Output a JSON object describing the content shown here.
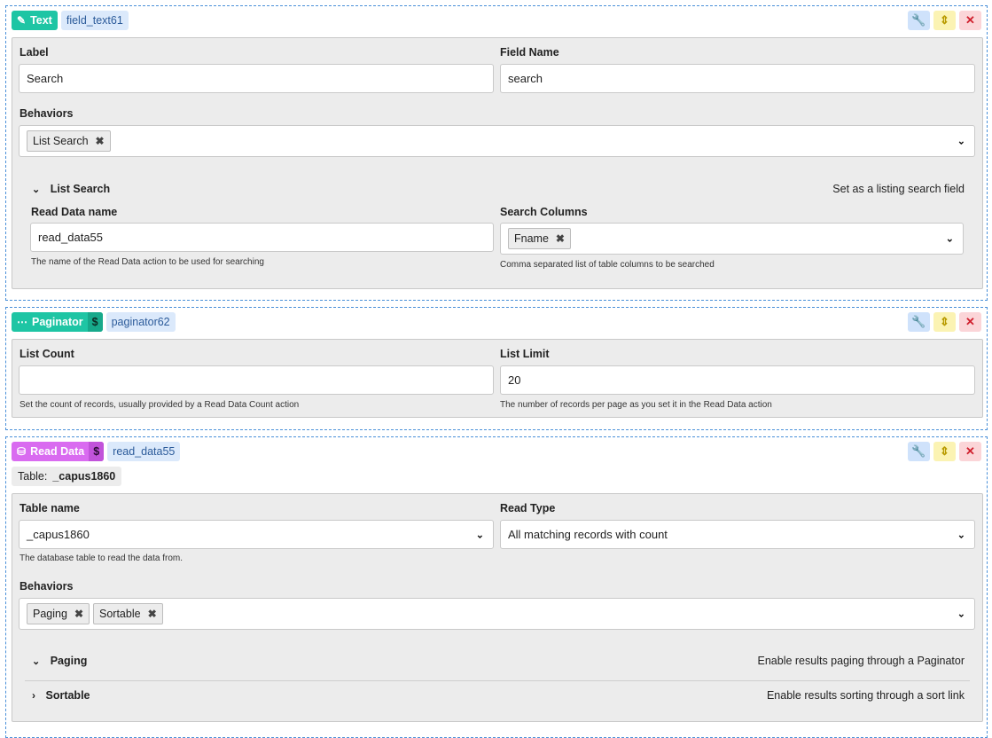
{
  "text_block": {
    "type_label": "Text",
    "id_label": "field_text61",
    "label_title": "Label",
    "label_value": "Search",
    "field_name_title": "Field Name",
    "field_name_value": "search",
    "behaviors_title": "Behaviors",
    "behaviors": [
      "List Search"
    ],
    "list_search": {
      "title": "List Search",
      "description": "Set as a listing search field",
      "read_data_title": "Read Data name",
      "read_data_value": "read_data55",
      "read_data_help": "The name of the Read Data action to be used for searching",
      "search_columns_title": "Search Columns",
      "search_columns": [
        "Fname"
      ],
      "search_columns_help": "Comma separated list of table columns to be searched"
    }
  },
  "paginator_block": {
    "type_label": "Paginator",
    "dollar": "$",
    "id_label": "paginator62",
    "list_count_title": "List Count",
    "list_count_value": "",
    "list_count_help": "Set the count of records, usually provided by a Read Data Count action",
    "list_limit_title": "List Limit",
    "list_limit_value": "20",
    "list_limit_help": "The number of records per page as you set it in the Read Data action"
  },
  "read_block": {
    "type_label": "Read Data",
    "dollar": "$",
    "id_label": "read_data55",
    "table_badge_label": "Table:",
    "table_badge_value": "_capus1860",
    "table_name_title": "Table name",
    "table_name_value": "_capus1860",
    "table_name_help": "The database table to read the data from.",
    "read_type_title": "Read Type",
    "read_type_value": "All matching records with count",
    "behaviors_title": "Behaviors",
    "behaviors": [
      "Paging",
      "Sortable"
    ],
    "paging": {
      "title": "Paging",
      "description": "Enable results paging through a Paginator"
    },
    "sortable": {
      "title": "Sortable",
      "description": "Enable results sorting through a sort link"
    }
  },
  "icons": {
    "text": "edit-icon",
    "paginator": "dots-icon",
    "read": "database-icon",
    "wrench": "wrench-icon",
    "move": "sort-icon",
    "delete": "close-icon"
  },
  "colors": {
    "teal": "#1ec5a4",
    "magenta": "#d96bf0",
    "dashed_border": "#4a90d9"
  }
}
